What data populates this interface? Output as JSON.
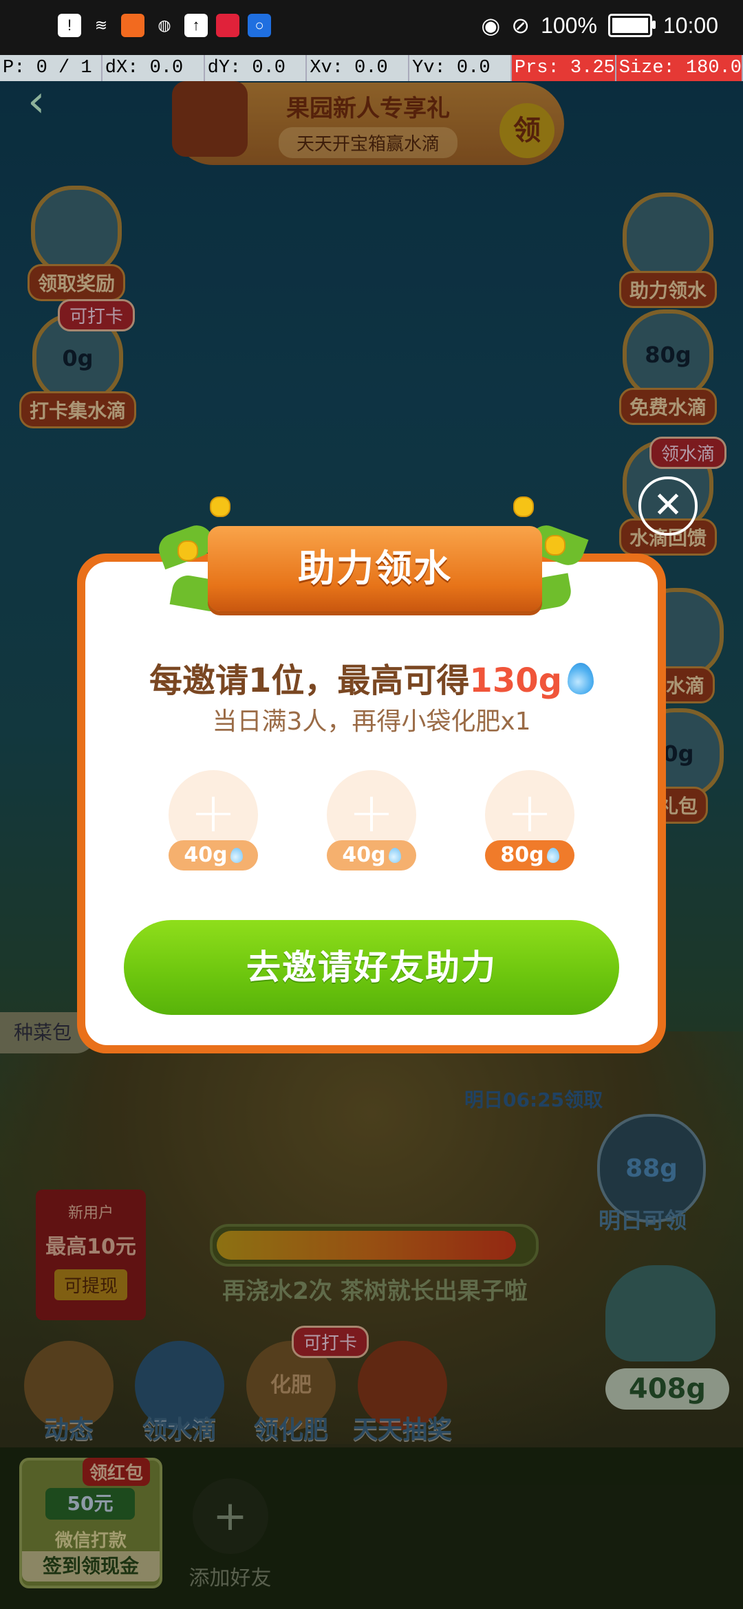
{
  "status_bar": {
    "battery": "100%",
    "time": "10:00"
  },
  "debug_overlay": {
    "p": "P: 0 / 1",
    "dx": "dX: 0.0",
    "dy": "dY: 0.0",
    "xv": "Xv: 0.0",
    "yv": "Yv: 0.0",
    "prs": "Prs: 3.25",
    "size": "Size: 180.0"
  },
  "background": {
    "banner_title": "果园新人专享礼",
    "banner_subtitle": "天天开宝箱赢水滴",
    "banner_claim": "领",
    "left_items": [
      {
        "label": "领取奖励",
        "value": ""
      },
      {
        "label": "打卡集水滴",
        "value": "0g",
        "tag": "可打卡"
      }
    ],
    "right_items": [
      {
        "label": "助力领水",
        "value": ""
      },
      {
        "label": "免费水滴",
        "value": "80g"
      },
      {
        "label": "水滴回馈",
        "value": "",
        "tag": "领水滴"
      },
      {
        "label": "g水滴",
        "value": ""
      },
      {
        "label": "礼包",
        "value": "0g"
      }
    ],
    "seed_label": "种菜包",
    "collect_time": "明日06:25领取",
    "bubble_value": "88g",
    "bubble_label": "明日可领",
    "new_user": {
      "tag": "新用户",
      "amount": "最高10元",
      "action": "可提现"
    },
    "progress_tip": "再浇水2次 茶树就长出果子啦",
    "progress": 0.95,
    "dock": [
      {
        "label": "动态"
      },
      {
        "label": "领水滴"
      },
      {
        "label": "领化肥",
        "tag": "可打卡",
        "inner": "化肥"
      },
      {
        "label": "天天抽奖"
      }
    ],
    "water_amount": "408g",
    "red_packet": {
      "tag": "领红包",
      "money": "50元",
      "mid": "微信打款",
      "bottom": "签到领现金"
    },
    "add_friend": "添加好友",
    "add_friend_plus": "+"
  },
  "modal": {
    "title": "助力领水",
    "headline_prefix": "每邀请1位，最高可得",
    "headline_amount": "130g",
    "subline": "当日满3人，再得小袋化肥x1",
    "slots": [
      {
        "amount": "40g",
        "style": "light"
      },
      {
        "amount": "40g",
        "style": "light"
      },
      {
        "amount": "80g",
        "style": "strong"
      }
    ],
    "slot_plus": "+",
    "invite_button": "去邀请好友助力",
    "close_symbol": "✕"
  },
  "colors": {
    "accent_orange": "#e9701a",
    "highlight_red": "#f0553a",
    "button_green": "#6cc50e",
    "text_brown": "#7a4722"
  }
}
